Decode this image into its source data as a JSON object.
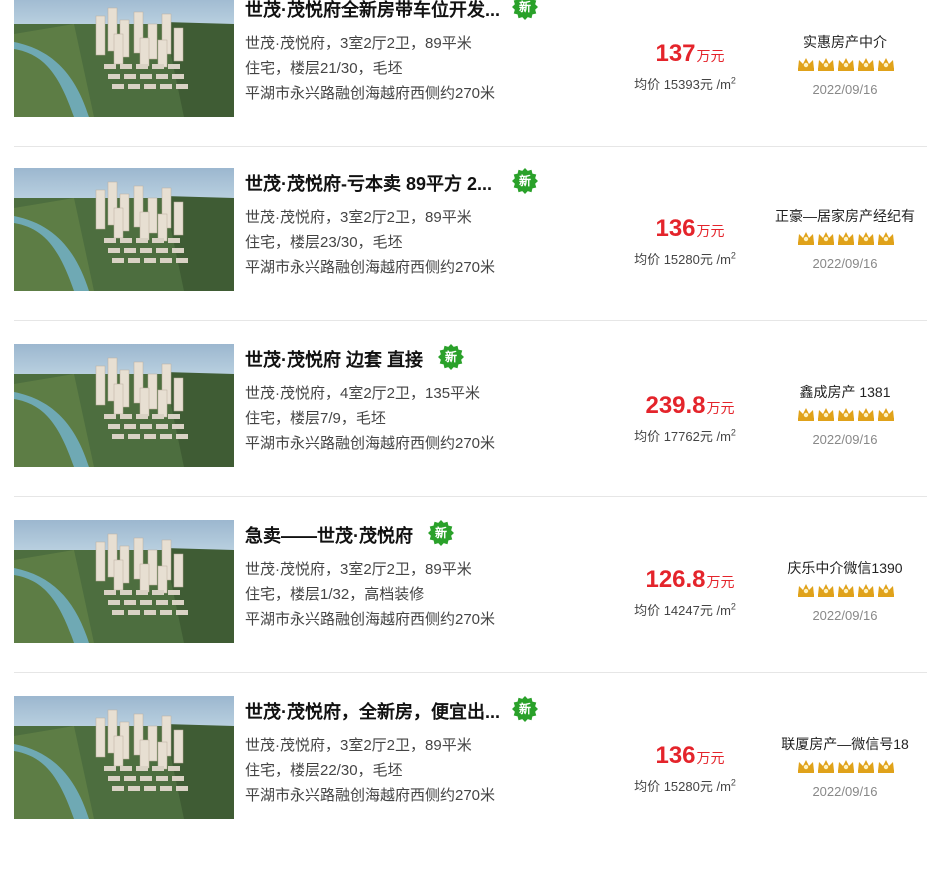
{
  "currency_unit": "万元",
  "unit_price_prefix": "均价",
  "unit_price_suffix": "元 /m",
  "unit_price_exp": "2",
  "badge_label": "新",
  "colors": {
    "price": "#e4242b",
    "badge": "#2aa12a",
    "star": "#e0a21a"
  },
  "listings": [
    {
      "title": "世茂·茂悦府全新房带车位开发...",
      "layout": "世茂·茂悦府，3室2厅2卫，89平米",
      "info": "住宅，楼层21/30，毛坯",
      "address": "平湖市永兴路融创海越府西侧约270米",
      "price": "137",
      "unit_price": "15393",
      "agent": "实惠房产中介",
      "rating": 5,
      "date": "2022/09/16"
    },
    {
      "title": "世茂·茂悦府-亏本卖 89平方 2...",
      "layout": "世茂·茂悦府，3室2厅2卫，89平米",
      "info": "住宅，楼层23/30，毛坯",
      "address": "平湖市永兴路融创海越府西侧约270米",
      "price": "136",
      "unit_price": "15280",
      "agent": "正豪—居家房产经纪有",
      "rating": 5,
      "date": "2022/09/16"
    },
    {
      "title": "世茂·茂悦府 边套 直接",
      "layout": "世茂·茂悦府，4室2厅2卫，135平米",
      "info": "住宅，楼层7/9，毛坯",
      "address": "平湖市永兴路融创海越府西侧约270米",
      "price": "239.8",
      "unit_price": "17762",
      "agent": "鑫成房产 1381",
      "rating": 5,
      "date": "2022/09/16"
    },
    {
      "title": "急卖——世茂·茂悦府",
      "layout": "世茂·茂悦府，3室2厅2卫，89平米",
      "info": "住宅，楼层1/32，高档装修",
      "address": "平湖市永兴路融创海越府西侧约270米",
      "price": "126.8",
      "unit_price": "14247",
      "agent": "庆乐中介微信1390",
      "rating": 5,
      "date": "2022/09/16"
    },
    {
      "title": "世茂·茂悦府，全新房，便宜出...",
      "layout": "世茂·茂悦府，3室2厅2卫，89平米",
      "info": "住宅，楼层22/30，毛坯",
      "address": "平湖市永兴路融创海越府西侧约270米",
      "price": "136",
      "unit_price": "15280",
      "agent": "联厦房产—微信号18",
      "rating": 5,
      "date": "2022/09/16"
    }
  ]
}
